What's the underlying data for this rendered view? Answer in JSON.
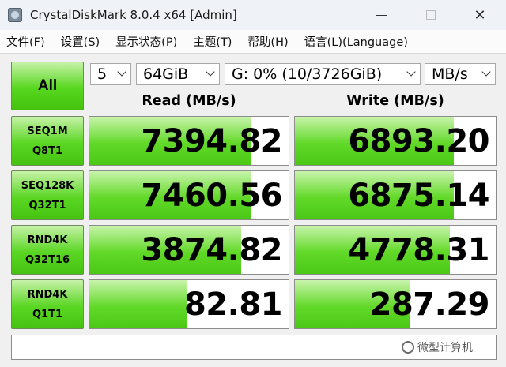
{
  "window": {
    "title": "CrystalDiskMark 8.0.4 x64 [Admin]",
    "minimize_icon": "minimize-icon",
    "maximize_icon": "maximize-icon",
    "close_glyph": "✕"
  },
  "menu": {
    "items": [
      "文件(F)",
      "设置(S)",
      "显示状态(P)",
      "主题(T)",
      "帮助(H)",
      "语言(L)(Language)"
    ]
  },
  "controls": {
    "all_label": "All",
    "count": "5",
    "size": "64GiB",
    "drive": "G: 0% (10/3726GiB)",
    "unit": "MB/s"
  },
  "columns": {
    "read": "Read (MB/s)",
    "write": "Write (MB/s)"
  },
  "tests": [
    {
      "line1": "SEQ1M",
      "line2": "Q8T1",
      "read": "7394.82",
      "write": "6893.20",
      "read_fill": 0.81,
      "write_fill": 0.79
    },
    {
      "line1": "SEQ128K",
      "line2": "Q32T1",
      "read": "7460.56",
      "write": "6875.14",
      "read_fill": 0.81,
      "write_fill": 0.79
    },
    {
      "line1": "RND4K",
      "line2": "Q32T16",
      "read": "3874.82",
      "write": "4778.31",
      "read_fill": 0.76,
      "write_fill": 0.77
    },
    {
      "line1": "RND4K",
      "line2": "Q1T1",
      "read": "82.81",
      "write": "287.29",
      "read_fill": 0.49,
      "write_fill": 0.57
    }
  ],
  "status_text": "",
  "watermark": "微型计算机",
  "colors": {
    "bar_green": "#62d928",
    "label_green": "#5ad623"
  }
}
